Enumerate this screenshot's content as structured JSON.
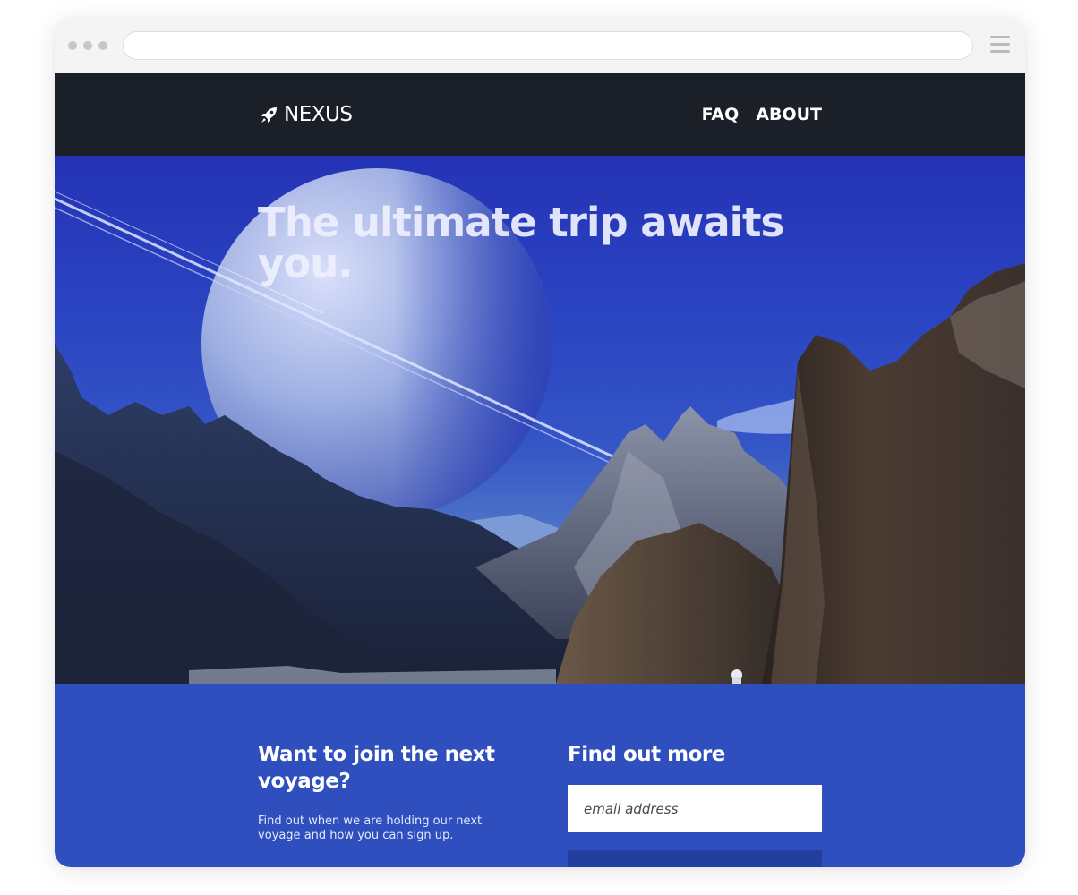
{
  "header": {
    "brand": "NEXUS",
    "nav": [
      "FAQ",
      "ABOUT"
    ]
  },
  "hero": {
    "title": "The ultimate trip awaits you."
  },
  "signup": {
    "left_title": "Want to join the next voyage?",
    "left_desc": "Find out when we are holding our next voyage and how you can sign up.",
    "right_title": "Find out more",
    "email_placeholder": "email address"
  },
  "icons": {
    "brand": "rocket-icon",
    "menu": "hamburger-menu-icon"
  },
  "colors": {
    "header_bg": "#1b1f28",
    "signup_bg": "#2e4fbd",
    "button_bg": "#233f9e"
  }
}
